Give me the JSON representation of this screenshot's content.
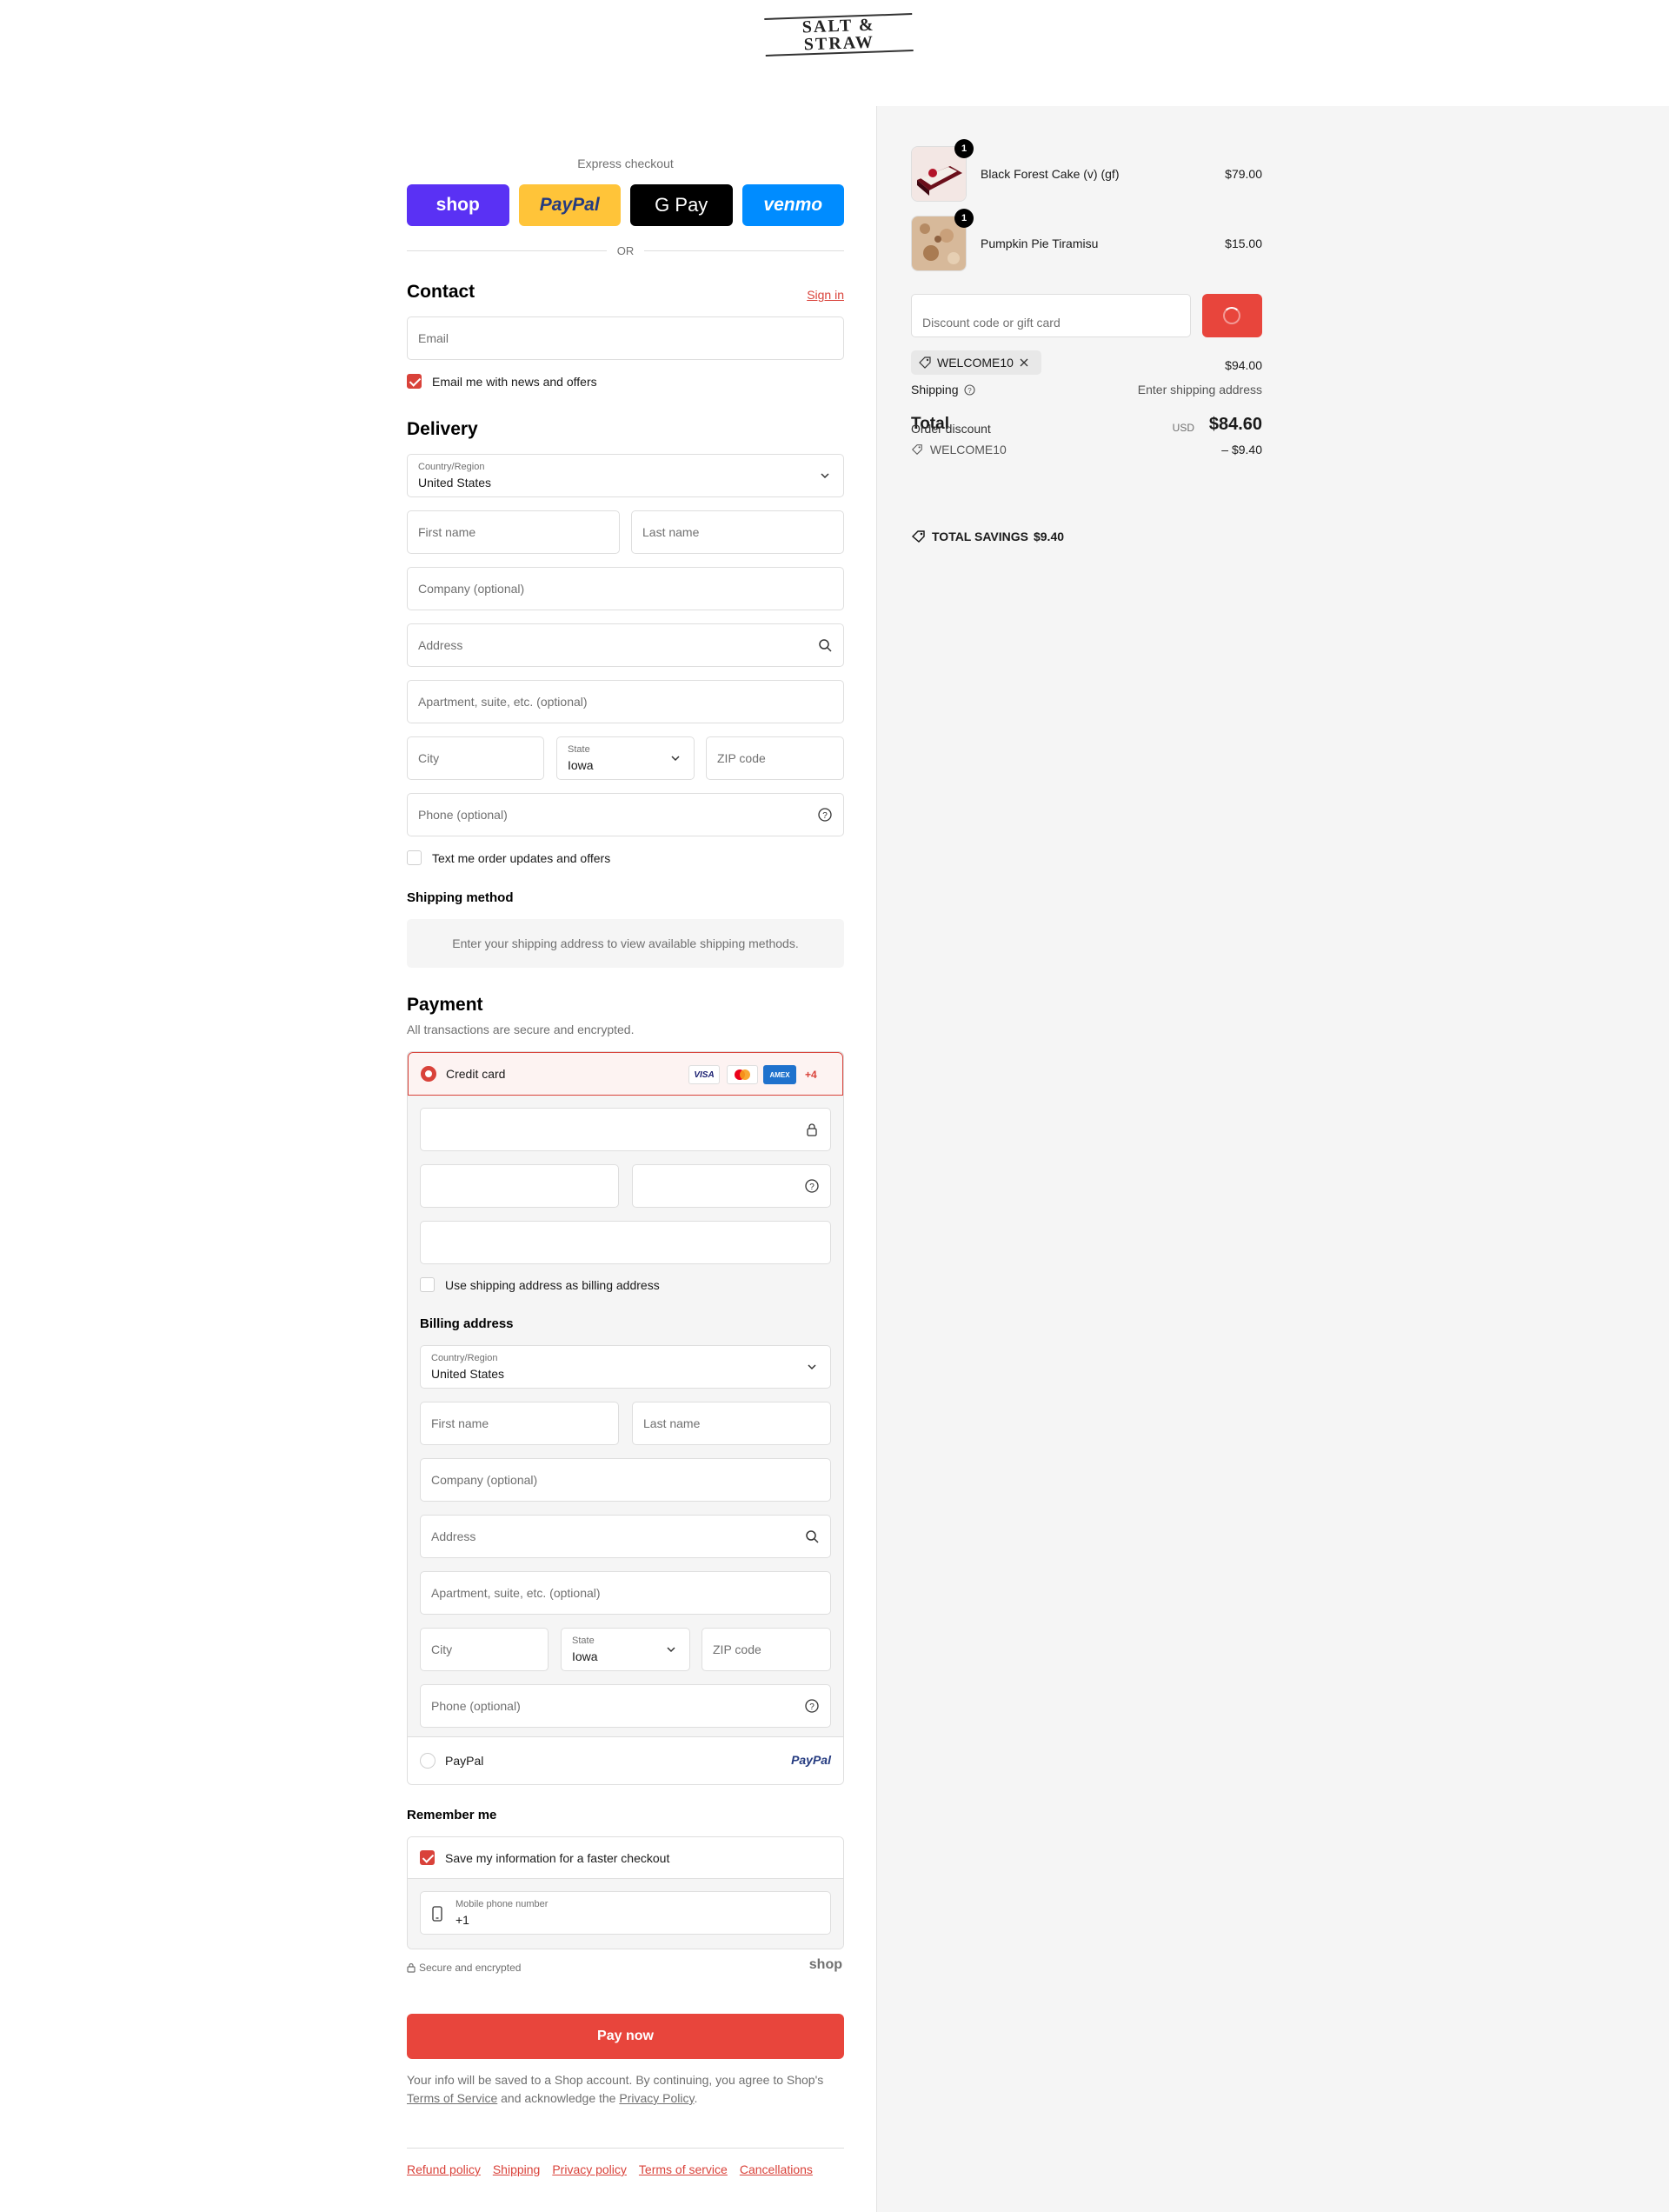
{
  "brand": {
    "name": "SALT & STRAW",
    "accent": "#d9423a"
  },
  "express": {
    "label": "Express checkout",
    "buttons": [
      "shop",
      "PayPal",
      "G Pay",
      "venmo"
    ],
    "or": "OR"
  },
  "contact": {
    "title": "Contact",
    "sign_in": "Sign in",
    "email_placeholder": "Email",
    "newsletter_label": "Email me with news and offers",
    "newsletter_checked": true
  },
  "delivery": {
    "title": "Delivery",
    "country_label": "Country/Region",
    "country_value": "United States",
    "first_name": "First name",
    "last_name": "Last name",
    "company": "Company (optional)",
    "address": "Address",
    "apartment": "Apartment, suite, etc. (optional)",
    "city": "City",
    "state_label": "State",
    "state_value": "Iowa",
    "zip": "ZIP code",
    "phone": "Phone (optional)",
    "sms_label": "Text me order updates and offers"
  },
  "shipping_method": {
    "title": "Shipping method",
    "message": "Enter your shipping address to view available shipping methods."
  },
  "payment": {
    "title": "Payment",
    "subtitle": "All transactions are secure and encrypted.",
    "credit_card_label": "Credit card",
    "card_brands": [
      "VISA",
      "mastercard",
      "AMEX"
    ],
    "more_brands": "+4",
    "use_shipping_label": "Use shipping address as billing address",
    "billing_title": "Billing address",
    "paypal_label": "PayPal",
    "paypal_logo": "PayPal"
  },
  "billing": {
    "country_label": "Country/Region",
    "country_value": "United States",
    "first_name": "First name",
    "last_name": "Last name",
    "company": "Company (optional)",
    "address": "Address",
    "apartment": "Apartment, suite, etc. (optional)",
    "city": "City",
    "state_label": "State",
    "state_value": "Iowa",
    "zip": "ZIP code",
    "phone": "Phone (optional)"
  },
  "remember": {
    "title": "Remember me",
    "save_label": "Save my information for a faster checkout",
    "save_checked": true,
    "mobile_label": "Mobile phone number",
    "mobile_value": "+1",
    "secure_text": "Secure and encrypted",
    "shop_logo": "shop"
  },
  "pay_now": "Pay now",
  "legal": {
    "before": "Your info will be saved to a Shop account. By continuing, you agree to Shop's ",
    "terms": "Terms of Service",
    "middle": " and acknowledge the ",
    "privacy": "Privacy Policy",
    "after": "."
  },
  "footer_links": [
    "Refund policy",
    "Shipping",
    "Privacy policy",
    "Terms of service",
    "Cancellations"
  ],
  "cart": {
    "items": [
      {
        "name": "Black Forest Cake (v) (gf)",
        "price": "$79.00",
        "qty": "1"
      },
      {
        "name": "Pumpkin Pie Tiramisu",
        "price": "$15.00",
        "qty": "1"
      }
    ],
    "discount_placeholder": "Discount code or gift card",
    "applied_code": "WELCOME10",
    "subtotal": "$94.00",
    "shipping_label": "Shipping",
    "shipping_value": "Enter shipping address",
    "order_discount_label": "Order discount",
    "discount_code": "WELCOME10",
    "discount_value": "– $9.40",
    "total_label": "Total",
    "currency": "USD",
    "total_value": "$84.60",
    "savings_label": "TOTAL SAVINGS",
    "savings_value": "$9.40"
  }
}
